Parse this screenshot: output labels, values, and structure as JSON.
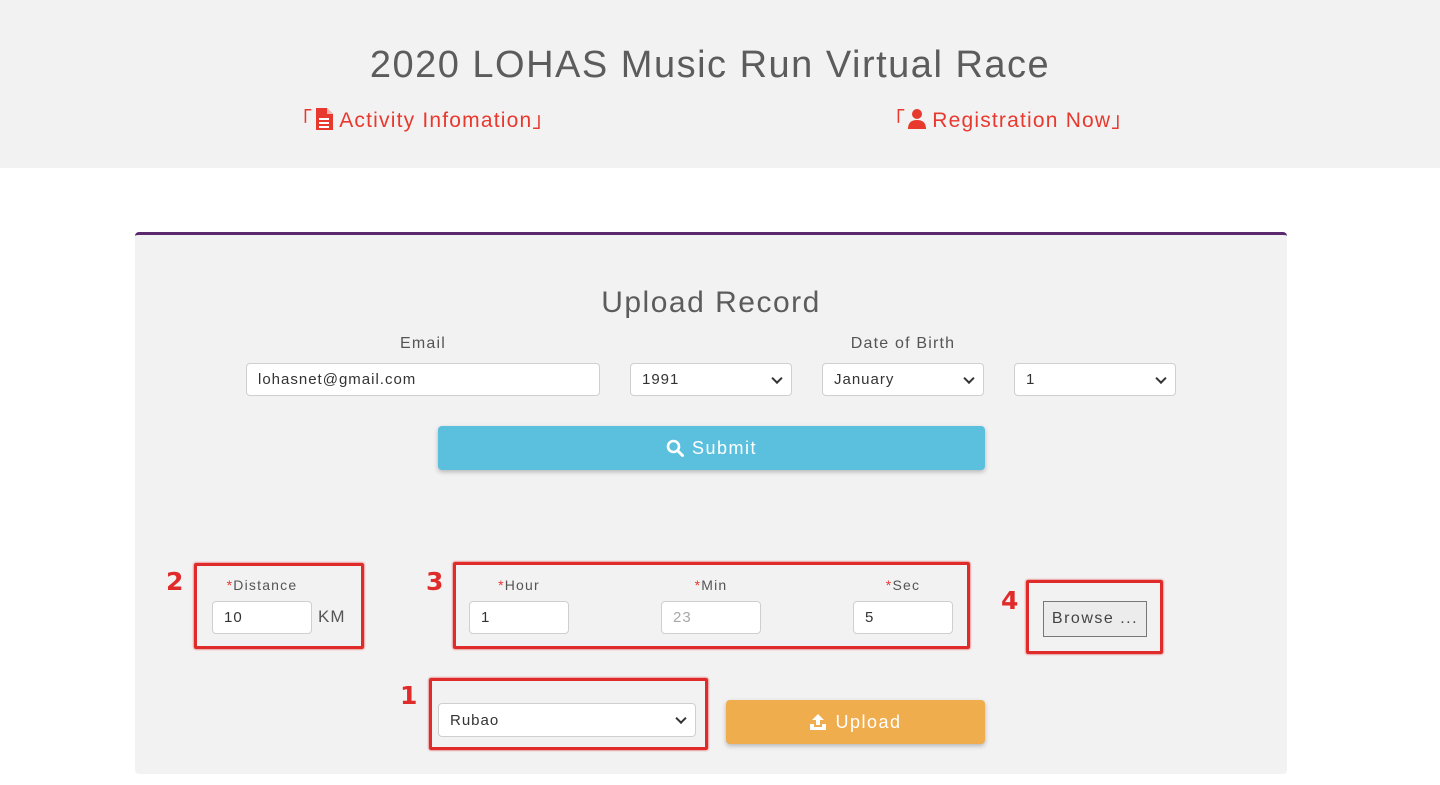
{
  "header": {
    "title": "2020 LOHAS Music Run Virtual Race",
    "activity_link": "「 Activity Infomation」",
    "register_link": "「 Registration Now」"
  },
  "form": {
    "title": "Upload Record",
    "email_label": "Email",
    "email_value": "lohasnet@gmail.com",
    "dob_label": "Date of Birth",
    "dob_year": "1991",
    "dob_month": "January",
    "dob_day": "1",
    "submit_label": "Submit"
  },
  "record": {
    "required_mark": "*",
    "distance_label": "Distance",
    "distance_value": "10",
    "distance_unit": "KM",
    "hour_label": "Hour",
    "hour_value": "1",
    "min_label": "Min",
    "min_placeholder": "23",
    "sec_label": "Sec",
    "sec_value": "5",
    "browse_label": "Browse ...",
    "location_value": "Rubao",
    "upload_label": "Upload"
  },
  "annotations": {
    "n1": "1",
    "n2": "2",
    "n3": "3",
    "n4": "4"
  },
  "colors": {
    "accent_red": "#e8392f",
    "submit_blue": "#5bc0de",
    "upload_orange": "#f0ad4e",
    "panel_border_purple": "#5b2a6e"
  },
  "icons": {
    "activity": "file-text-icon",
    "register": "user-icon",
    "submit": "search-icon",
    "upload": "upload-icon"
  }
}
